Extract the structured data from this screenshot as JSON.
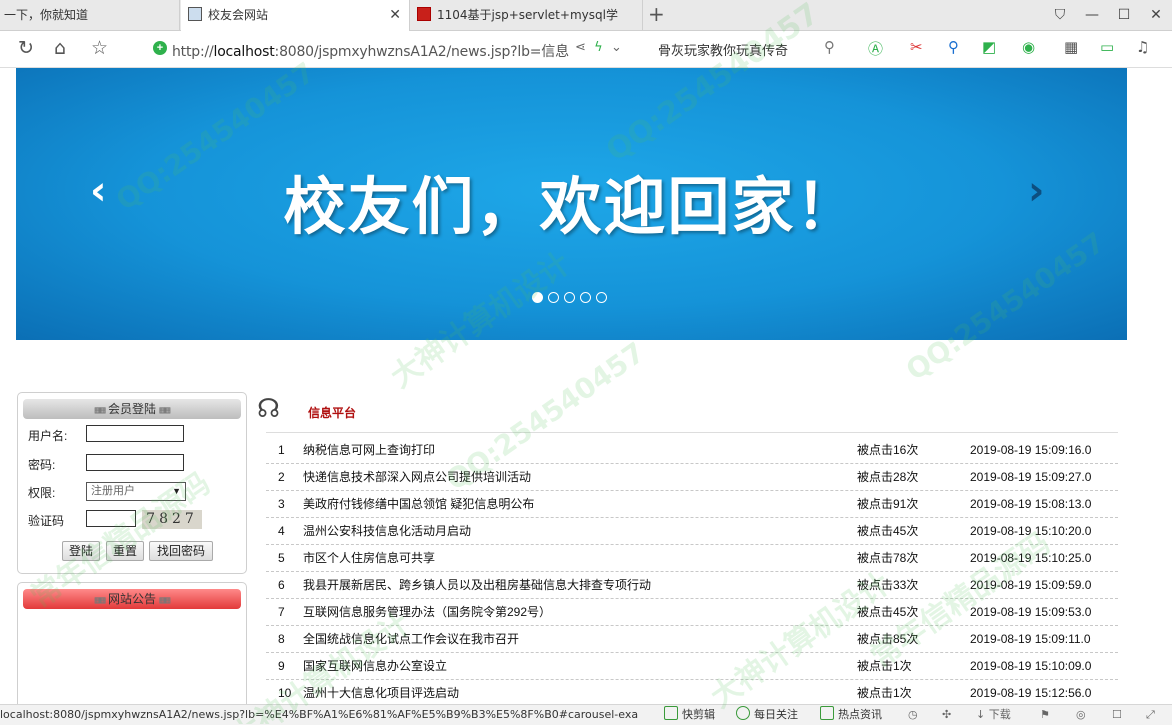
{
  "browser": {
    "tabs": [
      {
        "label": "一下，你就知道",
        "active": false
      },
      {
        "label": "校友会网站",
        "active": true
      },
      {
        "label": "1104基于jsp+servlet+mysql学",
        "active": false
      }
    ],
    "new_tab_glyph": "+",
    "url_prefix": "http://",
    "url_host": "localhost",
    "url_rest": ":8080/jspmxyhwznsA1A2/news.jsp?lb=信息",
    "search_text": "骨灰玩家教你玩真传奇",
    "icons": [
      "refresh-icon",
      "home-icon",
      "star-icon",
      "shield-icon",
      "share-icon",
      "lightning-icon",
      "dropdown-icon",
      "search-icon",
      "translate-icon",
      "scissors-icon",
      "magnifier-icon",
      "gamepad-icon",
      "coin-icon",
      "grid-icon",
      "battery-icon",
      "headphones-icon"
    ],
    "window_controls": [
      "shirt-icon",
      "minimize-icon",
      "maximize-icon",
      "close-icon"
    ]
  },
  "banner": {
    "text": "校友们，欢迎回家！",
    "slide_count": 5,
    "active_slide": 1,
    "prev_glyph": "‹",
    "next_glyph": "›"
  },
  "login": {
    "header": "会员登陆",
    "username_label": "用户名:",
    "password_label": "密码:",
    "role_label": "权限:",
    "role_value": "注册用户",
    "captcha_label": "验证码",
    "captcha_value": "7827",
    "login_button": "登陆",
    "reset_button": "重置",
    "forgot_button": "找回密码"
  },
  "notice": {
    "header": "网站公告"
  },
  "news": {
    "section_title": "信息平台",
    "items": [
      {
        "num": "1",
        "title": "纳税信息可网上查询打印",
        "hits": "被点击16次",
        "time": "2019-08-19 15:09:16.0"
      },
      {
        "num": "2",
        "title": "快递信息技术部深入网点公司提供培训活动",
        "hits": "被点击28次",
        "time": "2019-08-19 15:09:27.0"
      },
      {
        "num": "3",
        "title": "美政府付钱修缮中国总领馆 疑犯信息明公布",
        "hits": "被点击91次",
        "time": "2019-08-19 15:08:13.0"
      },
      {
        "num": "4",
        "title": "温州公安科技信息化活动月启动",
        "hits": "被点击45次",
        "time": "2019-08-19 15:10:20.0"
      },
      {
        "num": "5",
        "title": "市区个人住房信息可共享",
        "hits": "被点击78次",
        "time": "2019-08-19 15:10:25.0"
      },
      {
        "num": "6",
        "title": "我县开展新居民、跨乡镇人员以及出租房基础信息大排查专项行动",
        "hits": "被点击33次",
        "time": "2019-08-19 15:09:59.0"
      },
      {
        "num": "7",
        "title": "互联网信息服务管理办法（国务院令第292号）",
        "hits": "被点击45次",
        "time": "2019-08-19 15:09:53.0"
      },
      {
        "num": "8",
        "title": "全国统战信息化试点工作会议在我市召开",
        "hits": "被点击85次",
        "time": "2019-08-19 15:09:11.0"
      },
      {
        "num": "9",
        "title": "国家互联网信息办公室设立",
        "hits": "被点击1次",
        "time": "2019-08-19 15:10:09.0"
      },
      {
        "num": "10",
        "title": "温州十大信息化项目评选启动",
        "hits": "被点击1次",
        "time": "2019-08-19 15:12:56.0"
      }
    ]
  },
  "statusbar": {
    "url": "localhost:8080/jspmxyhwznsA1A2/news.jsp?lb=%E4%BF%A1%E6%81%AF%E5%B9%B3%E5%8F%B0#carousel-exa",
    "items": [
      "快剪辑",
      "每日关注",
      "热点资讯",
      "下载"
    ]
  },
  "watermark": {
    "lines": [
      "QQ:254540457",
      "大神计算机设计",
      "常年信精品源码"
    ]
  }
}
